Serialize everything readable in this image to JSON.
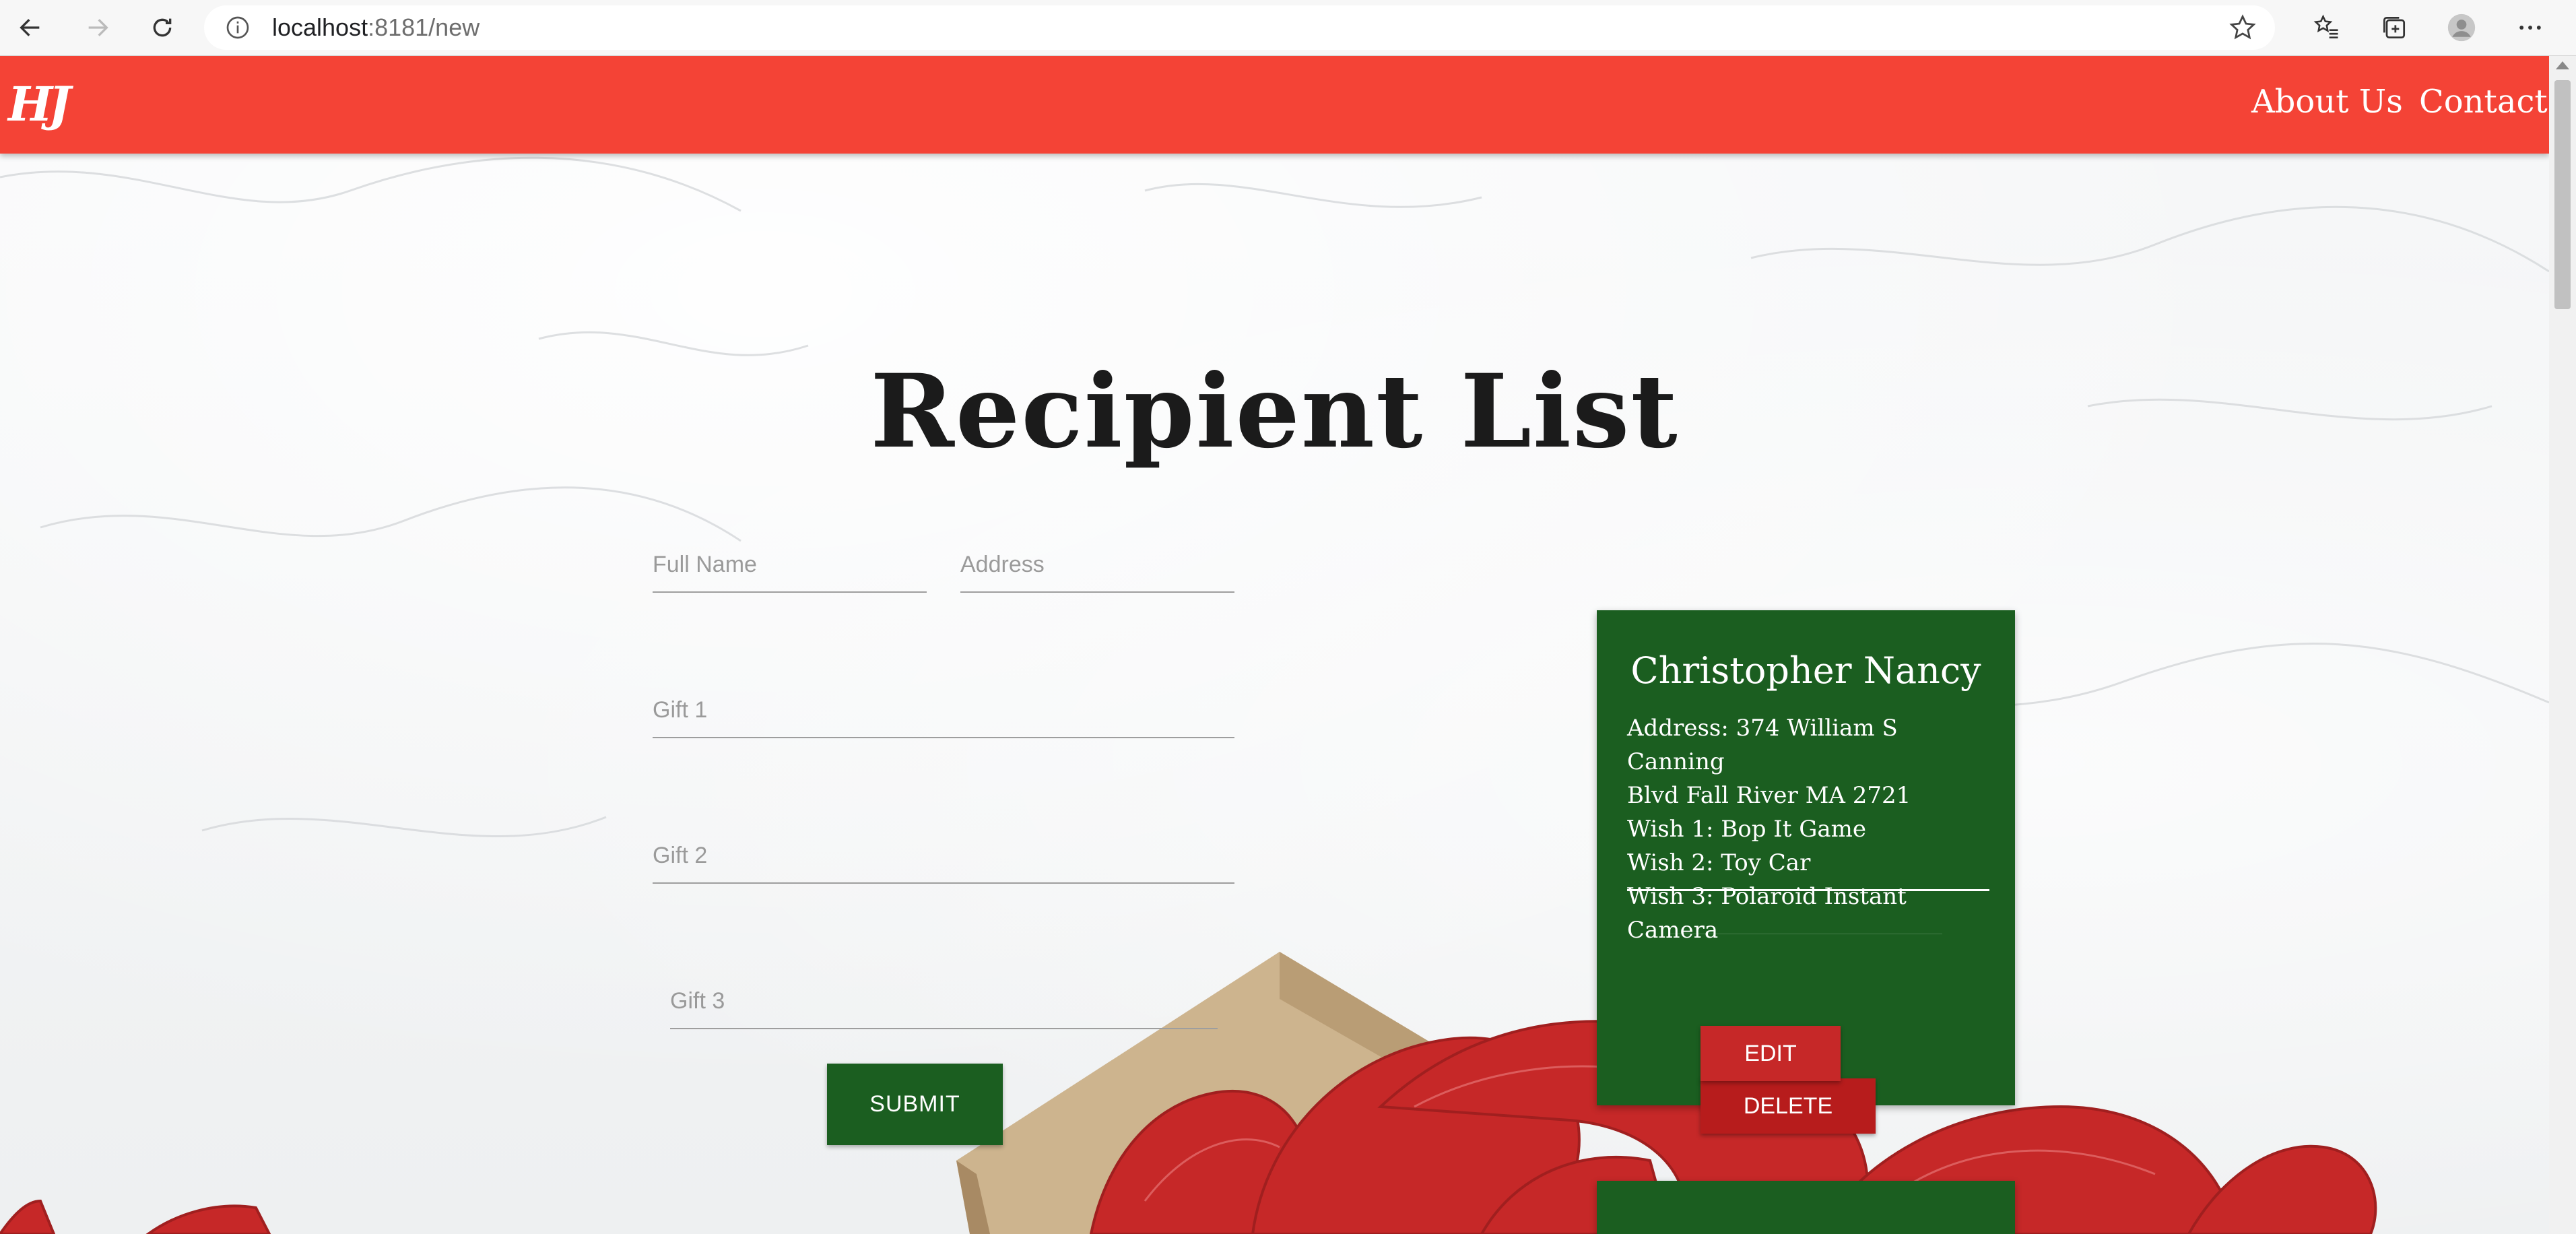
{
  "browser": {
    "url_host": "localhost",
    "url_rest": ":8181/new",
    "icons": [
      "back-arrow-icon",
      "forward-arrow-icon",
      "refresh-icon",
      "info-icon",
      "star-icon",
      "favorites-icon",
      "collections-icon",
      "profile-icon",
      "more-icon"
    ]
  },
  "header": {
    "logo": "HJ",
    "nav": [
      "About Us",
      "Contact"
    ],
    "color": "#f44336"
  },
  "page": {
    "title": "Recipient List"
  },
  "form": {
    "full_name_placeholder": "Full Name",
    "address_placeholder": "Address",
    "gift1_placeholder": "Gift 1",
    "gift2_placeholder": "Gift 2",
    "gift3_placeholder": "Gift 3",
    "submit_label": "SUBMIT"
  },
  "recipients": [
    {
      "name": "Christopher Nancy",
      "address_line1": "Address: 374 William S Canning",
      "address_line2": "Blvd Fall River MA 2721",
      "wish1": "Wish 1: Bop It Game",
      "wish2": "Wish 2: Toy Car",
      "wish3": "Wish 3: Polaroid Instant Camera",
      "edit_label": "EDIT",
      "delete_label": "DELETE"
    }
  ],
  "colors": {
    "card": "#1b5e20",
    "button_red": "#c62828",
    "ribbon": "#c62828"
  }
}
